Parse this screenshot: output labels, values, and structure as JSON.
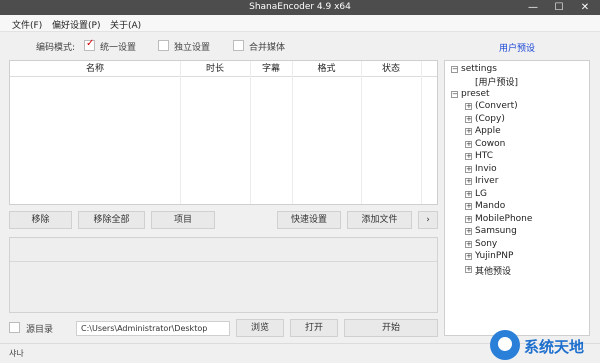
{
  "window": {
    "title": "ShanaEncoder 4.9 x64",
    "min": "—",
    "max": "☐",
    "close": "✕"
  },
  "menu": {
    "file": "文件(F)",
    "prefs": "偏好设置(P)",
    "about": "关于(A)"
  },
  "options": {
    "mode_label": "编码模式:",
    "unified_label": "统一设置",
    "unified_checked": true,
    "independent_label": "独立设置",
    "merge_label": "合并媒体",
    "user_presets_link": "用户预设"
  },
  "filelist": {
    "columns": [
      "名称",
      "时长",
      "字幕",
      "格式",
      "状态"
    ]
  },
  "tree": {
    "nodes": [
      {
        "label": "settings",
        "expander": "−",
        "depth": 0
      },
      {
        "label": "[用户预设]",
        "expander": "",
        "depth": 1
      },
      {
        "label": "preset",
        "expander": "−",
        "depth": 0
      },
      {
        "label": "(Convert)",
        "expander": "+",
        "depth": 1
      },
      {
        "label": "(Copy)",
        "expander": "+",
        "depth": 1
      },
      {
        "label": "Apple",
        "expander": "+",
        "depth": 1
      },
      {
        "label": "Cowon",
        "expander": "+",
        "depth": 1
      },
      {
        "label": "HTC",
        "expander": "+",
        "depth": 1
      },
      {
        "label": "Invio",
        "expander": "+",
        "depth": 1
      },
      {
        "label": "Iriver",
        "expander": "+",
        "depth": 1
      },
      {
        "label": "LG",
        "expander": "+",
        "depth": 1
      },
      {
        "label": "Mando",
        "expander": "+",
        "depth": 1
      },
      {
        "label": "MobilePhone",
        "expander": "+",
        "depth": 1
      },
      {
        "label": "Samsung",
        "expander": "+",
        "depth": 1
      },
      {
        "label": "Sony",
        "expander": "+",
        "depth": 1
      },
      {
        "label": "YujinPNP",
        "expander": "+",
        "depth": 1
      },
      {
        "label": "其他预设",
        "expander": "+",
        "depth": 1
      }
    ]
  },
  "actions": {
    "remove": "移除",
    "remove_all": "移除全部",
    "item": "项目",
    "quick_settings": "快速设置",
    "add_file": "添加文件",
    "more": "›"
  },
  "bottom": {
    "source_dir_label": "源目录",
    "path": "C:\\Users\\Administrator\\Desktop",
    "browse": "浏览",
    "open": "打开",
    "start": "开始"
  },
  "status": {
    "text": "샤나"
  },
  "watermark": {
    "text": "系统天地"
  },
  "colors": {
    "titlebar": "#4d4d4d",
    "link": "#1a47d6",
    "check": "#d40000"
  }
}
